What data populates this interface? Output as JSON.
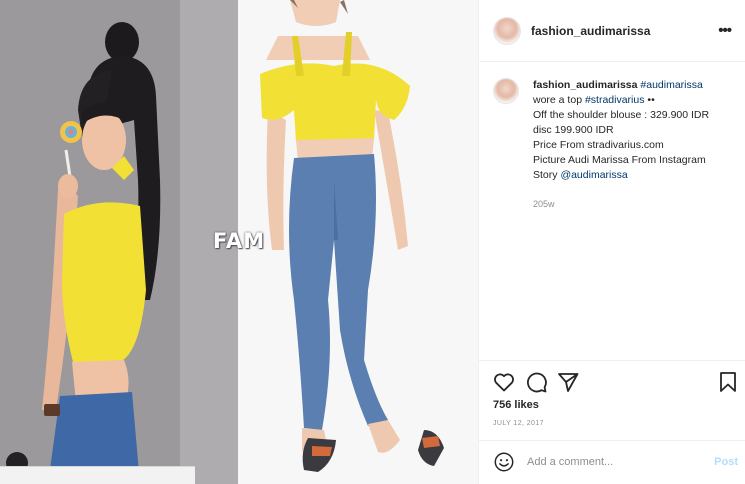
{
  "post": {
    "username": "fashion_audimarissa",
    "more_icon": "•••",
    "watermark": "FAM",
    "caption": {
      "username": "fashion_audimarissa",
      "hashtag_1": "#audimarissa",
      "line_1_text": "wore a top",
      "hashtag_2": "#stradivarius",
      "line_1_suffix": "••",
      "line_2": "Off the shoulder blouse : 329.900 IDR",
      "line_3": "disc 199.900 IDR",
      "line_4": "Price From stradivarius.com",
      "line_5": "Picture Audi Marissa From Instagram",
      "line_6_text": "Story",
      "mention": "@audimarissa",
      "time_ago": "205w"
    },
    "likes": "756 likes",
    "date": "JULY 12, 2017",
    "comment": {
      "placeholder": "Add a comment...",
      "post_label": "Post"
    }
  },
  "colors": {
    "link": "#00376b",
    "secondary_text": "#8e8e8e",
    "post_button": "#b2dffc",
    "top_yellow": "#f3e035",
    "jeans_blue": "#5a7fb0"
  },
  "icons": [
    "more-icon",
    "heart-icon",
    "comment-icon",
    "share-icon",
    "bookmark-icon",
    "emoji-icon"
  ]
}
